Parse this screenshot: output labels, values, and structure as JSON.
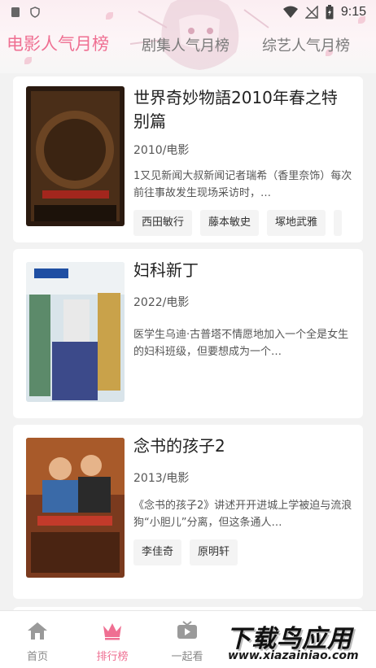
{
  "status": {
    "time": "9:15",
    "left_icons": [
      "sim-card-icon",
      "shield-icon"
    ],
    "right_icons": [
      "wifi-icon",
      "no-signal-icon",
      "battery-charging-icon"
    ]
  },
  "tabs": [
    {
      "label": "电影人气月榜",
      "active": true
    },
    {
      "label": "剧集人气月榜",
      "active": false
    },
    {
      "label": "综艺人气月榜",
      "active": false
    }
  ],
  "items": [
    {
      "title": "世界奇妙物語2010年春之特别篇",
      "meta": "2010/电影",
      "desc": "1又见新闻大叔新闻记者瑞希（香里奈饰）每次前往事故发生现场采访时，…",
      "tags": [
        "西田敏行",
        "藤本敏史",
        "塚地武雅",
        ""
      ]
    },
    {
      "title": "妇科新丁",
      "meta": "2022/电影",
      "desc": "医学生乌迪·古普塔不情愿地加入一个全是女生的妇科班级，但要想成为一个…",
      "tags": []
    },
    {
      "title": "念书的孩子2",
      "meta": "2013/电影",
      "desc": "《念书的孩子2》讲述开开进城上学被迫与流浪狗“小胆儿”分离，但这条通人…",
      "tags": [
        "李佳奇",
        "原明轩"
      ]
    }
  ],
  "nav": [
    {
      "label": "首页",
      "icon": "home-icon",
      "active": false
    },
    {
      "label": "排行榜",
      "icon": "crown-icon",
      "active": true
    },
    {
      "label": "一起看",
      "icon": "tv-icon",
      "active": false
    }
  ],
  "watermark": {
    "cn": "下载鸟应用",
    "en": "www.xiazainiao.com"
  },
  "colors": {
    "accent": "#ef6f92",
    "background": "#f2f2f2"
  }
}
